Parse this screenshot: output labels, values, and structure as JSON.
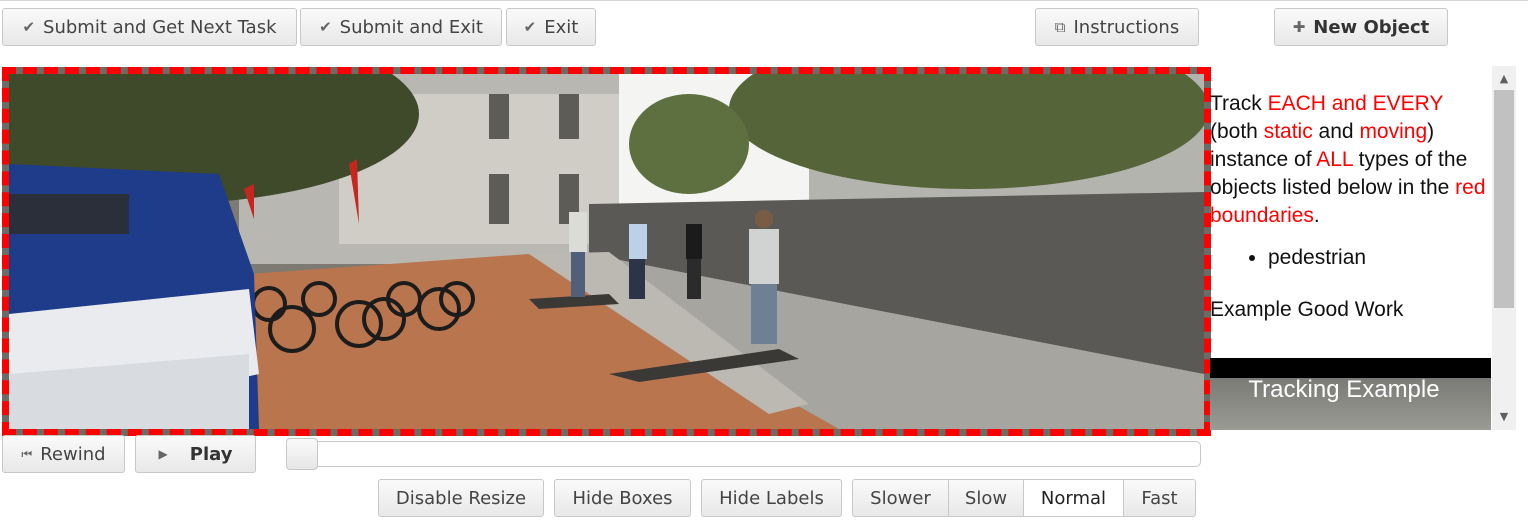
{
  "toolbar": {
    "submit_next": "Submit and Get Next Task",
    "submit_exit": "Submit and Exit",
    "exit": "Exit",
    "instructions": "Instructions",
    "new_object": "New Object"
  },
  "icons": {
    "check": "check-icon",
    "external": "external-window-icon",
    "plus": "plus-icon",
    "rewind": "rewind-icon",
    "play": "play-icon"
  },
  "colors": {
    "boundary": "#ff0000",
    "highlight": "#ff0000"
  },
  "instructions_panel": {
    "intro_1": "Track ",
    "intro_2": "EACH and EVERY",
    "intro_3": " (both ",
    "intro_4": "static",
    "intro_5": " and ",
    "intro_6": "moving",
    "intro_7": ") instance of ",
    "intro_8": "ALL",
    "intro_9": " types of the objects listed below in the ",
    "intro_10": "red boundaries",
    "intro_11": ".",
    "objects": [
      "pedestrian"
    ],
    "example_heading": "Example Good Work",
    "video_title": "Tracking Example"
  },
  "playback": {
    "rewind": "Rewind",
    "play": "Play",
    "progress": 0
  },
  "controls": {
    "disable_resize": "Disable Resize",
    "hide_boxes": "Hide Boxes",
    "hide_labels": "Hide Labels",
    "speeds": [
      "Slower",
      "Slow",
      "Normal",
      "Fast"
    ],
    "selected_speed": "Normal"
  }
}
